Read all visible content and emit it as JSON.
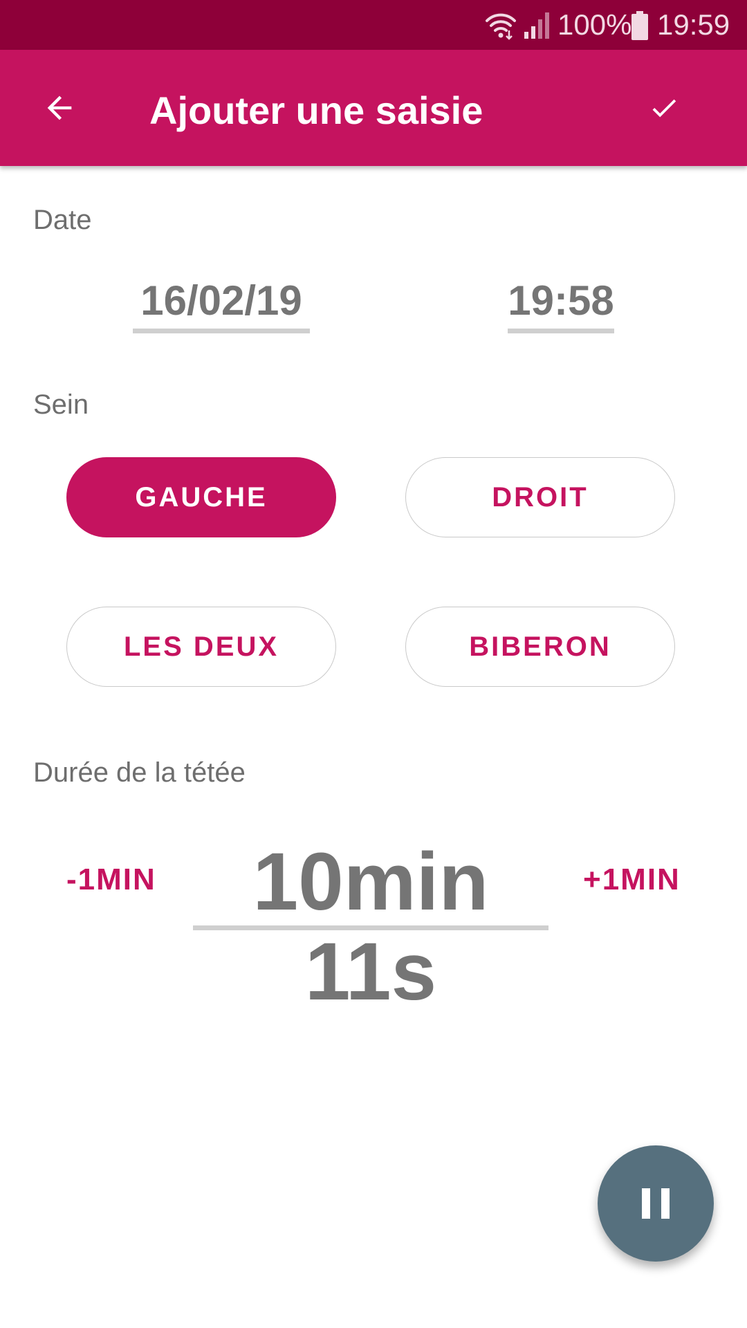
{
  "status_bar": {
    "wifi_icon": "wifi-icon",
    "signal_icon": "cell-signal-icon",
    "battery_level": "100%",
    "battery_icon": "battery-icon",
    "time": "19:59"
  },
  "app_bar": {
    "back_icon": "arrow-back-icon",
    "title": "Ajouter une saisie",
    "confirm_icon": "check-icon"
  },
  "date_section": {
    "label": "Date",
    "date": "16/02/19",
    "time": "19:58"
  },
  "breast_section": {
    "label": "Sein",
    "options": [
      {
        "label": "GAUCHE",
        "selected": true
      },
      {
        "label": "DROIT",
        "selected": false
      },
      {
        "label": "LES DEUX",
        "selected": false
      },
      {
        "label": "BIBERON",
        "selected": false
      }
    ]
  },
  "duration_section": {
    "label": "Durée de la tétée",
    "minus_label": "-1MIN",
    "value": "10min 11s",
    "plus_label": "+1MIN"
  },
  "fab": {
    "icon": "pause-icon"
  },
  "colors": {
    "status_bar": "#8e0039",
    "primary": "#c5135f",
    "fab": "#56707e",
    "text_secondary": "#757575"
  }
}
